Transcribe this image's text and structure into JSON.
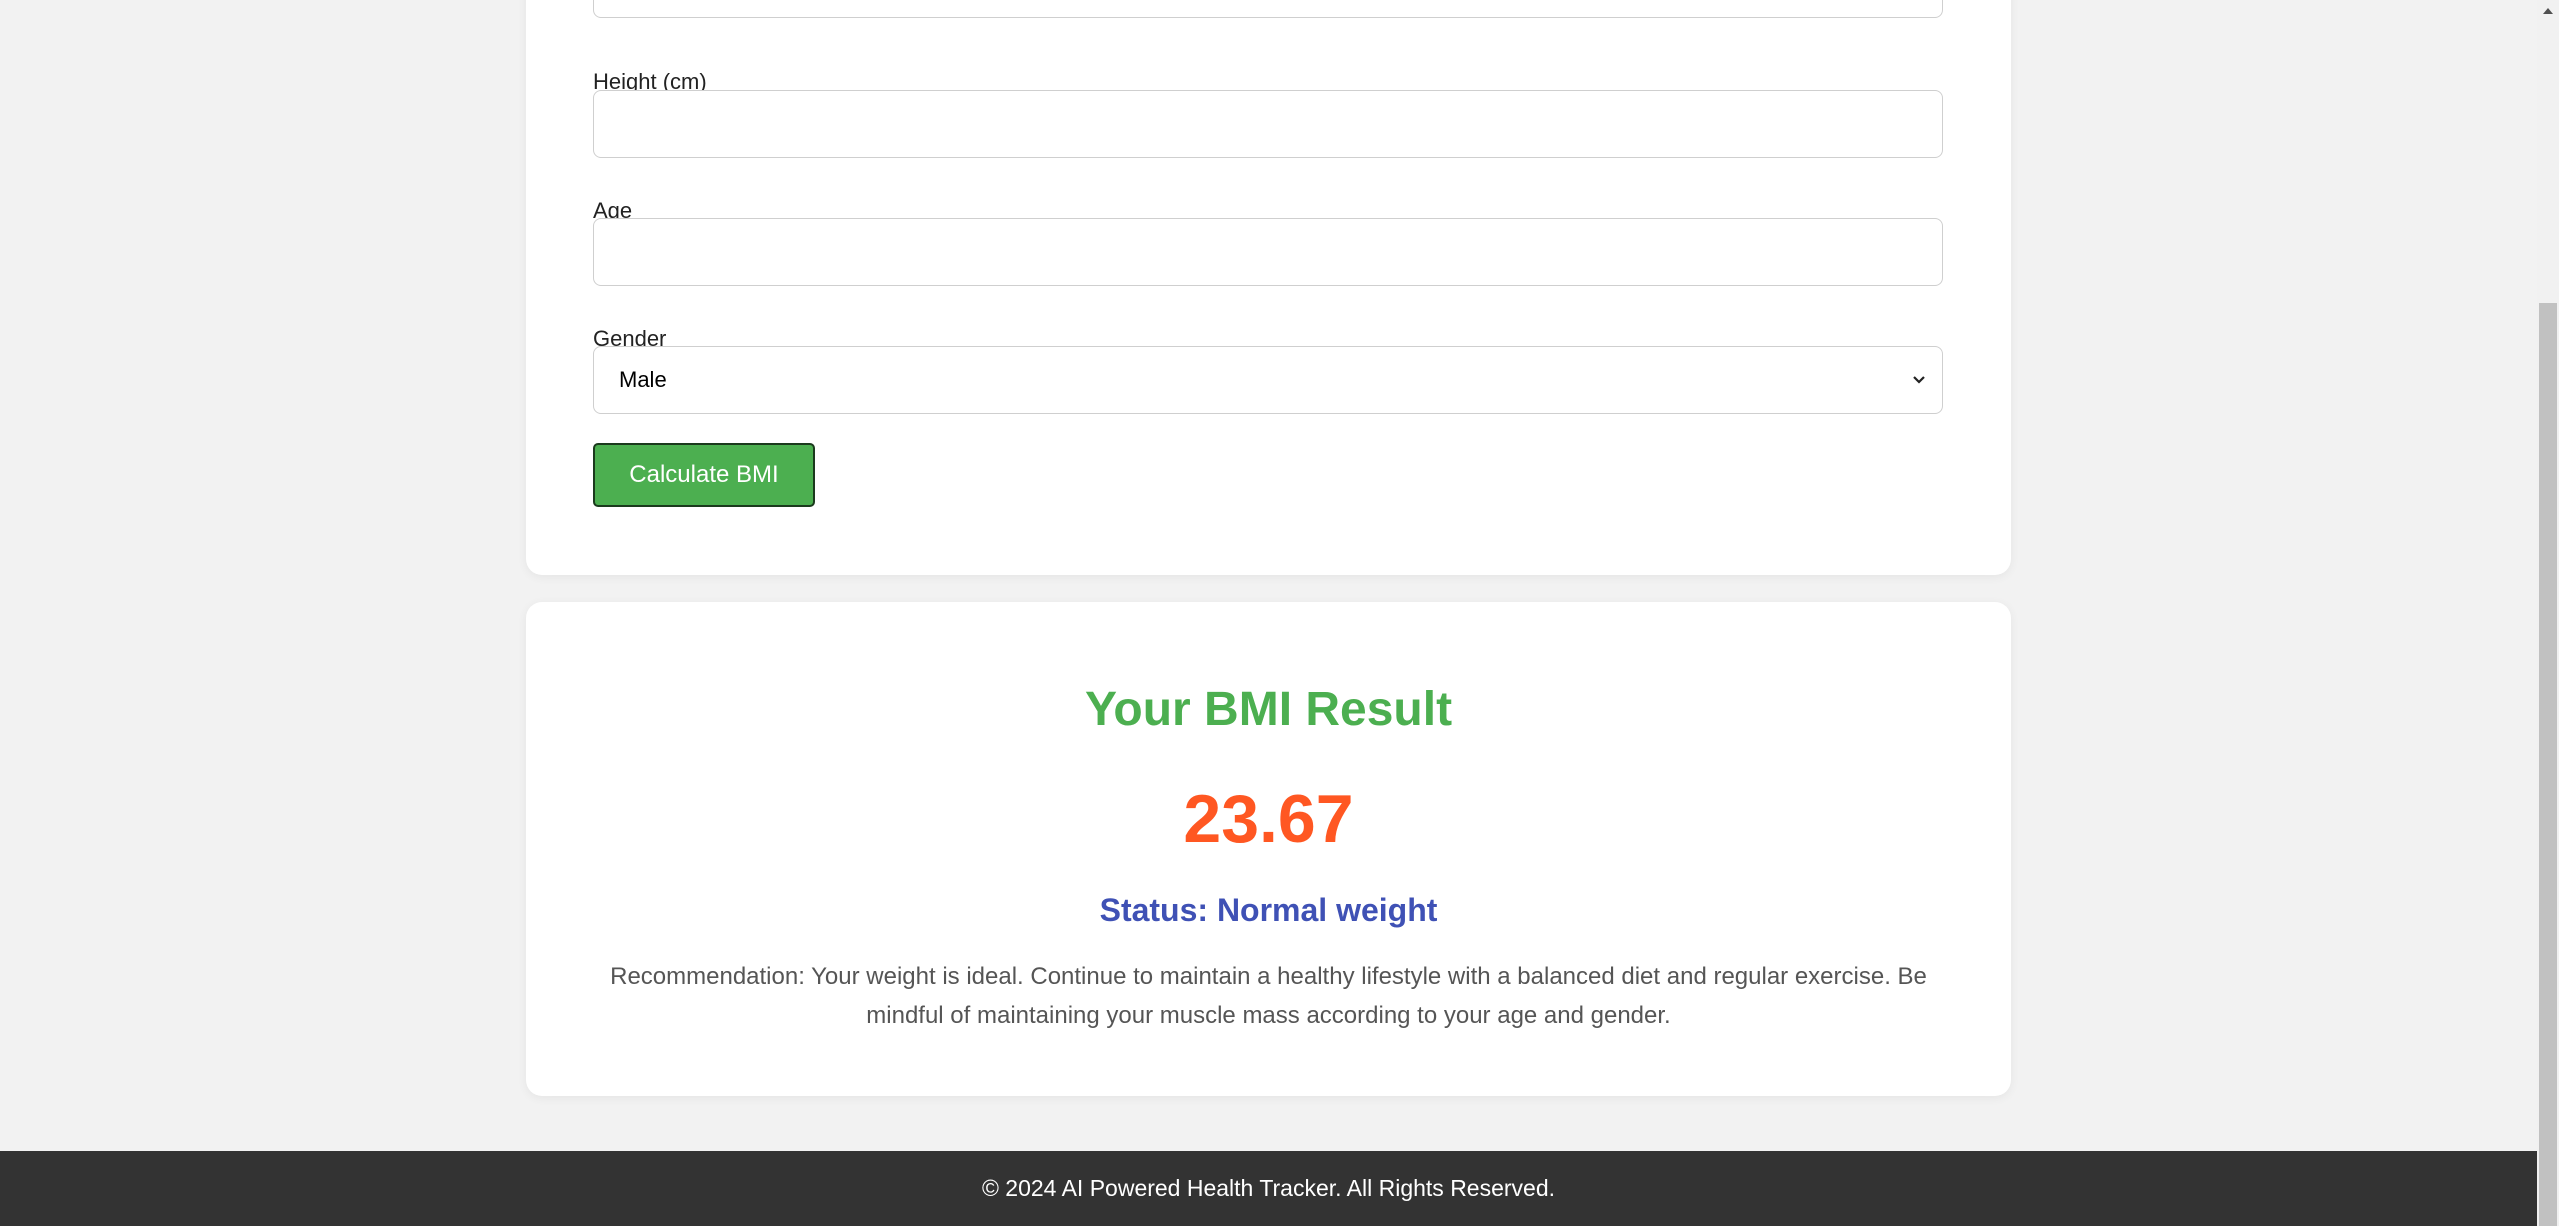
{
  "form": {
    "height_label": "Height (cm)",
    "height_value": "",
    "age_label": "Age",
    "age_value": "",
    "gender_label": "Gender",
    "gender_selected": "Male",
    "calculate_button": "Calculate BMI"
  },
  "result": {
    "title": "Your BMI Result",
    "bmi_value": "23.67",
    "status": "Status: Normal weight",
    "recommendation": "Recommendation: Your weight is ideal. Continue to maintain a healthy lifestyle with a balanced diet and regular exercise. Be mindful of maintaining your muscle mass according to your age and gender."
  },
  "footer": {
    "text": "© 2024 AI Powered Health Tracker. All Rights Reserved."
  },
  "colors": {
    "accent_green": "#4caf50",
    "bmi_orange": "#ff5722",
    "status_blue": "#3f51b5",
    "footer_bg": "#333333"
  },
  "icons": {
    "select_arrow": "chevron-down-icon",
    "scroll_up": "scroll-up-arrow-icon"
  }
}
